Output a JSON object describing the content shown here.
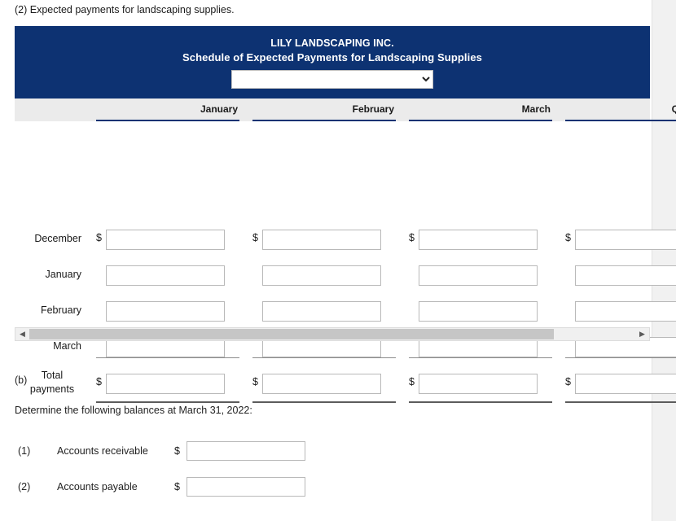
{
  "prompt": "(2) Expected payments for landscaping supplies.",
  "schedule": {
    "company": "LILY LANDSCAPING INC.",
    "title": "Schedule of Expected Payments for Landscaping Supplies",
    "period_select": {
      "value": "",
      "options": [
        ""
      ]
    },
    "columns": [
      "January",
      "February",
      "March",
      "Quarter"
    ],
    "rows": [
      {
        "label": "December",
        "show_dollar": true,
        "values": [
          "",
          "",
          "",
          ""
        ]
      },
      {
        "label": "January",
        "show_dollar": false,
        "values": [
          "",
          "",
          "",
          ""
        ]
      },
      {
        "label": "February",
        "show_dollar": false,
        "values": [
          "",
          "",
          "",
          ""
        ]
      },
      {
        "label": "March",
        "show_dollar": false,
        "values": [
          "",
          "",
          "",
          ""
        ]
      },
      {
        "label": "Total payments",
        "show_dollar": true,
        "values": [
          "",
          "",
          "",
          ""
        ]
      }
    ],
    "dollar_sign": "$"
  },
  "scrollbar": {
    "left_arrow": "◀",
    "right_arrow": "▶"
  },
  "part_b": {
    "label": "(b)",
    "instruction": "Determine the following balances at March 31, 2022:",
    "items": [
      {
        "num": "(1)",
        "label": "Accounts receivable",
        "dollar": "$",
        "value": ""
      },
      {
        "num": "(2)",
        "label": "Accounts payable",
        "dollar": "$",
        "value": ""
      }
    ]
  },
  "colors": {
    "header_blue": "#0d3272",
    "col_head_bg": "#ebebeb"
  }
}
